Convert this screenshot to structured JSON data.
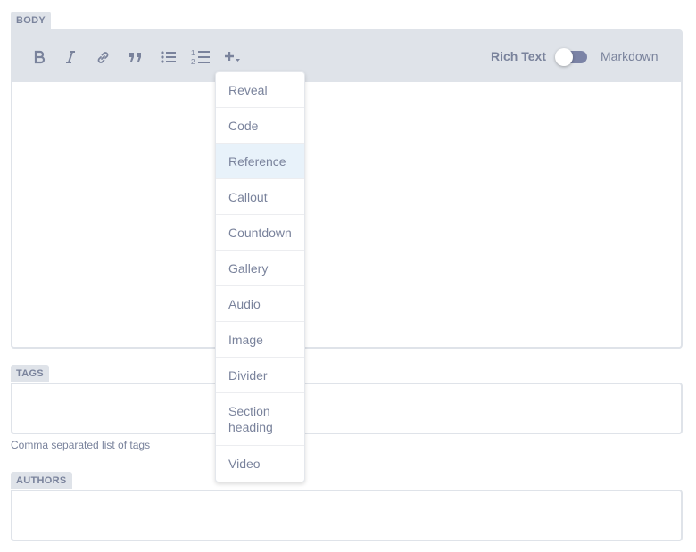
{
  "body_field": {
    "label": "BODY",
    "toolbar": {
      "buttons": [
        {
          "name": "bold-button",
          "icon": "bold-icon"
        },
        {
          "name": "italic-button",
          "icon": "italic-icon"
        },
        {
          "name": "link-button",
          "icon": "link-icon"
        },
        {
          "name": "quote-button",
          "icon": "quote-icon"
        },
        {
          "name": "bulleted-list-button",
          "icon": "bulleted-list-icon"
        },
        {
          "name": "numbered-list-button",
          "icon": "numbered-list-icon"
        },
        {
          "name": "add-component-button",
          "icon": "plus-dropdown-icon"
        }
      ],
      "mode_rich_label": "Rich Text",
      "mode_markdown_label": "Markdown",
      "toggle_state": "rich-text"
    },
    "insert_menu": {
      "items": [
        "Reveal",
        "Code",
        "Reference",
        "Callout",
        "Countdown",
        "Gallery",
        "Audio",
        "Image",
        "Divider",
        "Section heading",
        "Video"
      ],
      "highlighted": "Reference"
    }
  },
  "tags_field": {
    "label": "TAGS",
    "value": "",
    "hint": "Comma separated list of tags"
  },
  "authors_field": {
    "label": "AUTHORS",
    "value": ""
  },
  "colors": {
    "label_bg": "#dfe3e9",
    "text": "#7a839c",
    "toggle_track": "#7b83a6",
    "menu_highlight": "#e8f2fa"
  }
}
